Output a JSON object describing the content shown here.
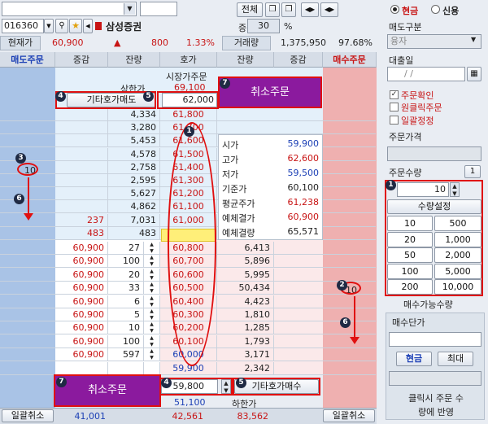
{
  "toolbar": {
    "code": "016360",
    "name": "삼성증권",
    "btn_all": "전체",
    "inc_label": "증",
    "inc_value": "30",
    "pct": "%"
  },
  "quote": {
    "cur_label": "현재가",
    "price": "60,900",
    "arrow": "▲",
    "change": "800",
    "rate": "1.33%",
    "vol_label": "거래량",
    "volume": "1,375,950",
    "vol_rate": "97.68%"
  },
  "headers": {
    "sell_order": "매도주문",
    "inc1": "증감",
    "rem1": "잔량",
    "price": "호가",
    "rem2": "잔량",
    "inc2": "증감",
    "buy_order": "매수주문"
  },
  "book": {
    "market_order": "시장가주문",
    "upper_label": "상한가",
    "upper_price": "69,100",
    "other_sell": "기타호가매도",
    "other_sell_qty": "62,000",
    "cancel": "취소주문",
    "other_buy": "기타호가매수",
    "other_buy_qty": "59,800",
    "lower_price": "51,100",
    "lower_label": "하한가",
    "bulk_cancel": "일괄취소",
    "total_sell_inc": "41,001",
    "total_sell": "42,561",
    "total_buy": "83,562",
    "sell_qty_input": "10",
    "buy_qty_input": "10"
  },
  "asks": [
    {
      "inc": "",
      "rem": "4,334",
      "price": "61,800"
    },
    {
      "inc": "",
      "rem": "3,280",
      "price": "61,700"
    },
    {
      "inc": "",
      "rem": "5,453",
      "price": "61,600"
    },
    {
      "inc": "",
      "rem": "4,578",
      "price": "61,500"
    },
    {
      "inc": "",
      "rem": "2,758",
      "price": "61,400"
    },
    {
      "inc": "",
      "rem": "2,595",
      "price": "61,300"
    },
    {
      "inc": "",
      "rem": "5,627",
      "price": "61,200"
    },
    {
      "inc": "",
      "rem": "4,862",
      "price": "61,100"
    },
    {
      "inc": "237",
      "rem": "7,031",
      "price": "61,000"
    },
    {
      "inc": "483",
      "rem": "483",
      "price": "60,900"
    }
  ],
  "bids": [
    {
      "my": "60,900",
      "myq": "27",
      "price": "60,800",
      "rem": "6,413"
    },
    {
      "my": "60,900",
      "myq": "100",
      "price": "60,700",
      "rem": "5,896"
    },
    {
      "my": "60,900",
      "myq": "20",
      "price": "60,600",
      "rem": "5,995"
    },
    {
      "my": "60,900",
      "myq": "33",
      "price": "60,500",
      "rem": "50,434"
    },
    {
      "my": "60,900",
      "myq": "6",
      "price": "60,400",
      "rem": "4,423"
    },
    {
      "my": "60,900",
      "myq": "5",
      "price": "60,300",
      "rem": "1,810"
    },
    {
      "my": "60,900",
      "myq": "10",
      "price": "60,200",
      "rem": "1,285"
    },
    {
      "my": "60,900",
      "myq": "100",
      "price": "60,100",
      "rem": "1,793"
    },
    {
      "my": "60,900",
      "myq": "597",
      "price": "60,000",
      "rem": "3,171"
    },
    {
      "my": "",
      "myq": "",
      "price": "59,900",
      "rem": "2,342"
    }
  ],
  "stats": [
    {
      "k": "시가",
      "v": "59,900",
      "c": "blue"
    },
    {
      "k": "고가",
      "v": "62,600",
      "c": "red"
    },
    {
      "k": "저가",
      "v": "59,500",
      "c": "blue"
    },
    {
      "k": "기준가",
      "v": "60,100",
      "c": ""
    },
    {
      "k": "평균주가",
      "v": "61,238",
      "c": "red"
    },
    {
      "k": "예체결가",
      "v": "60,900",
      "c": "red"
    },
    {
      "k": "예체결량",
      "v": "65,571",
      "c": ""
    }
  ],
  "side": {
    "cash": "현금",
    "credit": "신용",
    "sell_type_label": "매도구분",
    "sell_type_value": "융자",
    "loan_date_label": "대출일",
    "loan_date": "/ /",
    "chk_confirm": "주문확인",
    "chk_oneclick": "원클릭주문",
    "chk_bulk": "일괄정정",
    "price_label": "주문가격",
    "qty_label": "주문수량",
    "qty_btn": "1",
    "qty_value": "10",
    "qty_set": "수량설정",
    "qty_grid": [
      "10",
      "500",
      "20",
      "1,000",
      "50",
      "2,000",
      "100",
      "5,000",
      "200",
      "10,000"
    ],
    "buyable": "매수가능수량",
    "unit_label": "매수단가",
    "cash_btn": "현금",
    "max_btn": "최대",
    "hint": "클릭시 주문 수량에 반영"
  },
  "markers": [
    "1",
    "2",
    "3",
    "4",
    "5",
    "6",
    "7"
  ]
}
